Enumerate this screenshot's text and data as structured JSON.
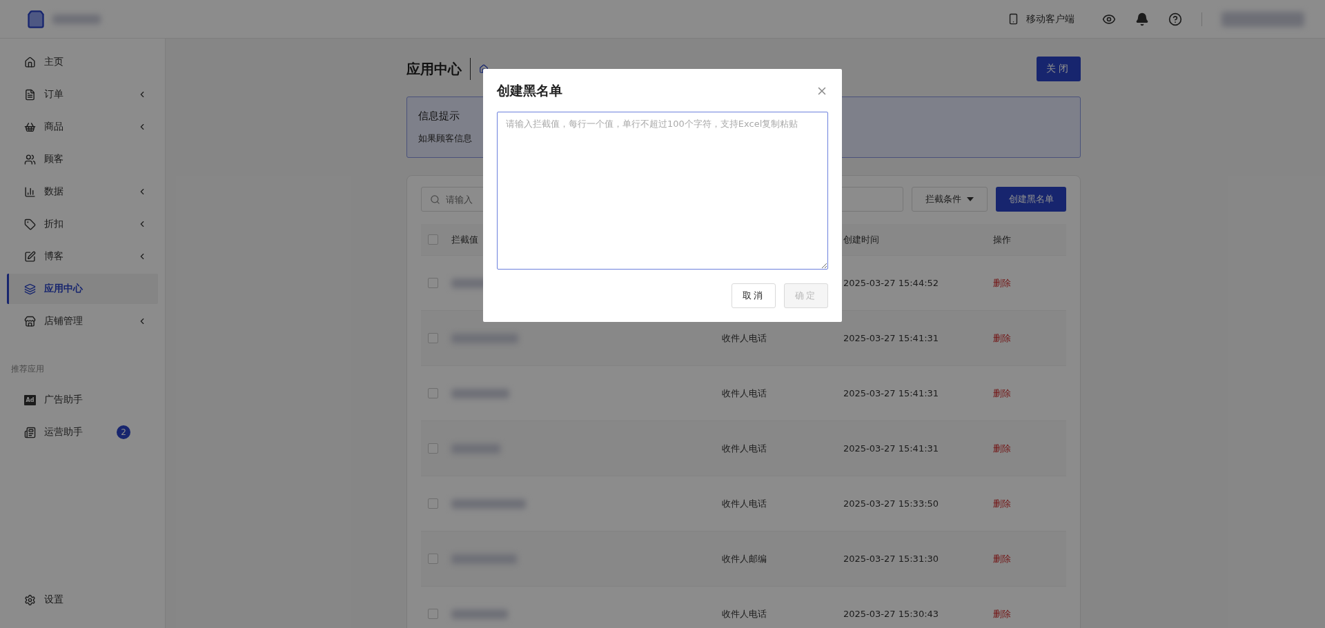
{
  "header": {
    "mobile_client": "移动客户端"
  },
  "sidebar": {
    "items": [
      {
        "label": "主页",
        "expandable": false,
        "selected": false
      },
      {
        "label": "订单",
        "expandable": true,
        "selected": false
      },
      {
        "label": "商品",
        "expandable": true,
        "selected": false
      },
      {
        "label": "顾客",
        "expandable": false,
        "selected": false
      },
      {
        "label": "数据",
        "expandable": true,
        "selected": false
      },
      {
        "label": "折扣",
        "expandable": true,
        "selected": false
      },
      {
        "label": "博客",
        "expandable": true,
        "selected": false
      },
      {
        "label": "应用中心",
        "expandable": false,
        "selected": true
      },
      {
        "label": "店铺管理",
        "expandable": true,
        "selected": false
      }
    ],
    "section_title": "推荐应用",
    "apps": [
      {
        "label": "广告助手",
        "icon_text": "Ad"
      },
      {
        "label": "运营助手",
        "badge": "2"
      }
    ],
    "settings": "设置"
  },
  "page": {
    "title": "应用中心",
    "close_button": "关闭"
  },
  "info": {
    "title": "信息提示",
    "text": "如果顾客信息"
  },
  "toolbar": {
    "search_placeholder": "请输入",
    "filter": "拦截条件",
    "create_button": "创建黑名单"
  },
  "table": {
    "select_all_checked": false,
    "columns": [
      "拦截值",
      "创建时间",
      "操作"
    ],
    "rows": [
      {
        "checked": false,
        "type": "",
        "time": "2025-03-27 15:44:52",
        "action": "删除"
      },
      {
        "checked": false,
        "type": "收件人电话",
        "time": "2025-03-27 15:41:31",
        "action": "删除"
      },
      {
        "checked": false,
        "type": "收件人电话",
        "time": "2025-03-27 15:41:31",
        "action": "删除"
      },
      {
        "checked": false,
        "type": "收件人电话",
        "time": "2025-03-27 15:41:31",
        "action": "删除"
      },
      {
        "checked": false,
        "type": "收件人电话",
        "time": "2025-03-27 15:33:50",
        "action": "删除"
      },
      {
        "checked": false,
        "type": "收件人邮编",
        "time": "2025-03-27 15:31:30",
        "action": "删除"
      },
      {
        "checked": false,
        "type": "收件人电话",
        "time": "2025-03-27 15:30:43",
        "action": "删除"
      }
    ]
  },
  "modal": {
    "title": "创建黑名单",
    "placeholder": "请输入拦截值，每行一个值，单行不超过100个字符，支持Excel复制粘贴",
    "cancel": "取消",
    "confirm": {
      "label": "确定",
      "disabled": true
    }
  }
}
